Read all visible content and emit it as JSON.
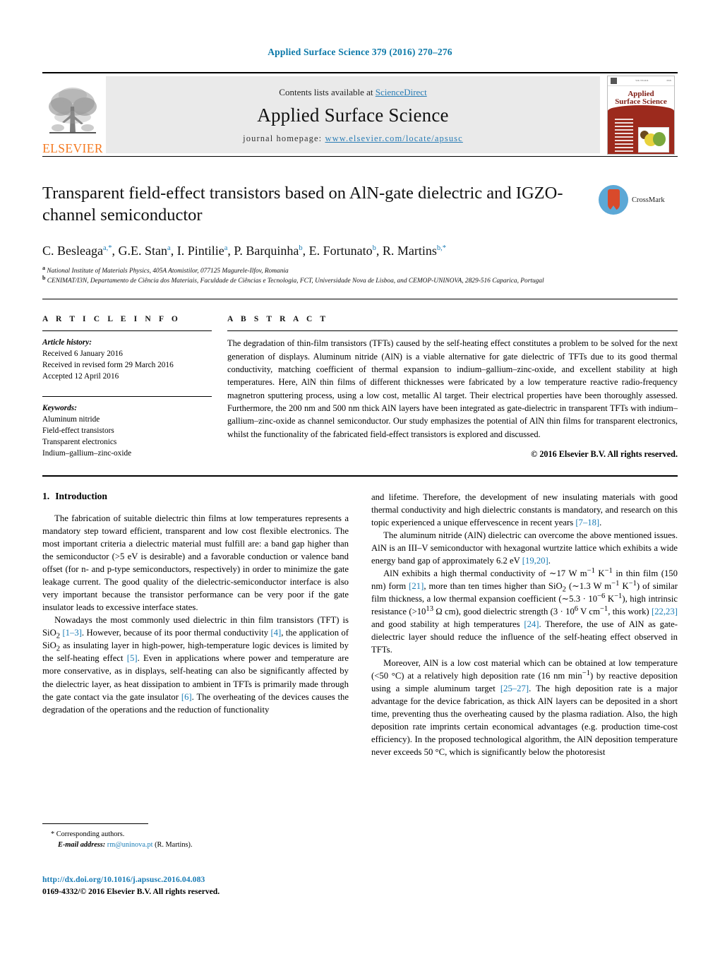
{
  "running_head": "Applied Surface Science 379 (2016) 270–276",
  "masthead": {
    "publisher_logo_label": "ELSEVIER",
    "contents_prefix": "Contents lists available at ",
    "contents_link": "ScienceDirect",
    "journal_title": "Applied Surface Science",
    "homepage_prefix": "journal homepage: ",
    "homepage_url": "www.elsevier.com/locate/apsusc",
    "cover": {
      "title_line1": "Applied",
      "title_line2": "Surface Science",
      "sub_line1": "A JOURNAL DEVOTED TO APPLIED PHYSICS",
      "sub_line2": "AND CHEMISTRY OF SURFACES AND INTERFACES",
      "red_line": "EDITORS: H. ASAHI ET AL."
    }
  },
  "article": {
    "title": "Transparent field-effect transistors based on AlN-gate dielectric and IGZO-channel semiconductor",
    "crossmark_label": "CrossMark",
    "authors_html": "C. Besleaga<sup class=\"mark\">a,*</sup>, G.E. Stan<sup class=\"mark\">a</sup>, I. Pintilie<sup class=\"mark\">a</sup>, P. Barquinha<sup class=\"mark\">b</sup>, E. Fortunato<sup class=\"mark\">b</sup>, R. Martins<sup class=\"mark\">b,*</sup>",
    "affiliation_a": "National Institute of Materials Physics, 405A Atomistilor, 077125 Magurele-Ilfov, Romania",
    "affiliation_b": "CENIMAT/I3N, Departamento de Ciência dos Materiais, Faculdade de Ciências e Tecnologia, FCT, Universidade Nova de Lisboa, and CEMOP-UNINOVA, 2829-516 Caparica, Portugal"
  },
  "article_info": {
    "heading": "A R T I C L E    I N F O",
    "history_label": "Article history:",
    "history": [
      "Received 6 January 2016",
      "Received in revised form 29 March 2016",
      "Accepted 12 April 2016"
    ],
    "keywords_label": "Keywords:",
    "keywords": [
      "Aluminum nitride",
      "Field-effect transistors",
      "Transparent electronics",
      "Indium–gallium–zinc-oxide"
    ]
  },
  "abstract": {
    "heading": "A B S T R A C T",
    "text": "The degradation of thin-film transistors (TFTs) caused by the self-heating effect constitutes a problem to be solved for the next generation of displays. Aluminum nitride (AlN) is a viable alternative for gate dielectric of TFTs due to its good thermal conductivity, matching coefficient of thermal expansion to indium–gallium–zinc-oxide, and excellent stability at high temperatures. Here, AlN thin films of different thicknesses were fabricated by a low temperature reactive radio-frequency magnetron sputtering process, using a low cost, metallic Al target. Their electrical properties have been thoroughly assessed. Furthermore, the 200 nm and 500 nm thick AlN layers have been integrated as gate-dielectric in transparent TFTs with indium–gallium–zinc-oxide as channel semiconductor. Our study emphasizes the potential of AlN thin films for transparent electronics, whilst the functionality of the fabricated field-effect transistors is explored and discussed.",
    "copyright": "© 2016 Elsevier B.V. All rights reserved."
  },
  "section": {
    "number": "1.",
    "title": "Introduction"
  },
  "body": {
    "left_paragraphs_html": [
      "The fabrication of suitable dielectric thin films at low temperatures represents a mandatory step toward efficient, transparent and low cost flexible electronics. The most important criteria a dielectric material must fulfill are: a band gap higher than the semiconductor (&gt;5 eV is desirable) and a favorable conduction or valence band offset (for n- and p-type semiconductors, respectively) in order to minimize the gate leakage current. The good quality of the dielectric-semiconductor interface is also very important because the transistor performance can be very poor if the gate insulator leads to excessive interface states.",
      "Nowadays the most commonly used dielectric in thin film transistors (TFT) is SiO<sub>2</sub> <span class=\"ref\">[1–3]</span>. However, because of its poor thermal conductivity <span class=\"ref\">[4]</span>, the application of SiO<sub>2</sub> as insulating layer in high-power, high-temperature logic devices is limited by the self-heating effect <span class=\"ref\">[5]</span>. Even in applications where power and temperature are more conservative, as in displays, self-heating can also be significantly affected by the dielectric layer, as heat dissipation to ambient in TFTs is primarily made through the gate contact via the gate insulator <span class=\"ref\">[6]</span>. The overheating of the devices causes the degradation of the operations and the reduction of functionality"
    ],
    "right_paragraphs_html": [
      "and lifetime. Therefore, the development of new insulating materials with good thermal conductivity and high dielectric constants is mandatory, and research on this topic experienced a unique effervescence in recent years <span class=\"ref\">[7–18]</span>.",
      "The aluminum nitride (AlN) dielectric can overcome the above mentioned issues. AlN is an III–V semiconductor with hexagonal wurtzite lattice which exhibits a wide energy band gap of approximately 6.2 eV <span class=\"ref\">[19,20]</span>.",
      "AlN exhibits a high thermal conductivity of ∼17 W m<sup>−1</sup> K<sup>−1</sup> in thin film (150 nm) form <span class=\"ref\">[21]</span>, more than ten times higher than SiO<sub>2</sub> (∼1.3 W m<sup>−1</sup> K<sup>−1</sup>) of similar film thickness, a low thermal expansion coefficient (∼5.3 · 10<sup>−6</sup> K<sup>−1</sup>), high intrinsic resistance (&gt;10<sup>13</sup> Ω cm), good dielectric strength (3 · 10<sup>6</sup> V cm<sup>−1</sup>, this work) <span class=\"ref\">[22,23]</span> and good stability at high temperatures <span class=\"ref\">[24]</span>. Therefore, the use of AlN as gate-dielectric layer should reduce the influence of the self-heating effect observed in TFTs.",
      "Moreover, AlN is a low cost material which can be obtained at low temperature (&lt;50 °C) at a relatively high deposition rate (16 nm min<sup>−1</sup>) by reactive deposition using a simple aluminum target <span class=\"ref\">[25–27]</span>. The high deposition rate is a major advantage for the device fabrication, as thick AlN layers can be deposited in a short time, preventing thus the overheating caused by the plasma radiation. Also, the high deposition rate imprints certain economical advantages (e.g. production time-cost efficiency). In the proposed technological algorithm, the AlN deposition temperature never exceeds 50 °C, which is significantly below the photoresist"
    ]
  },
  "footnote": {
    "corresponding": "* Corresponding authors.",
    "email_label": "E-mail address:",
    "email": "rm@uninova.pt",
    "email_suffix": "(R. Martins).",
    "doi": "http://dx.doi.org/10.1016/j.apsusc.2016.04.083",
    "issn": "0169-4332/© 2016 Elsevier B.V. All rights reserved."
  },
  "colors": {
    "link": "#1a7cb5",
    "running_head": "#0b78a8",
    "elsevier_orange": "#f47920",
    "crossmark_blue": "#5ca8d6",
    "crossmark_red": "#d94a2b"
  }
}
